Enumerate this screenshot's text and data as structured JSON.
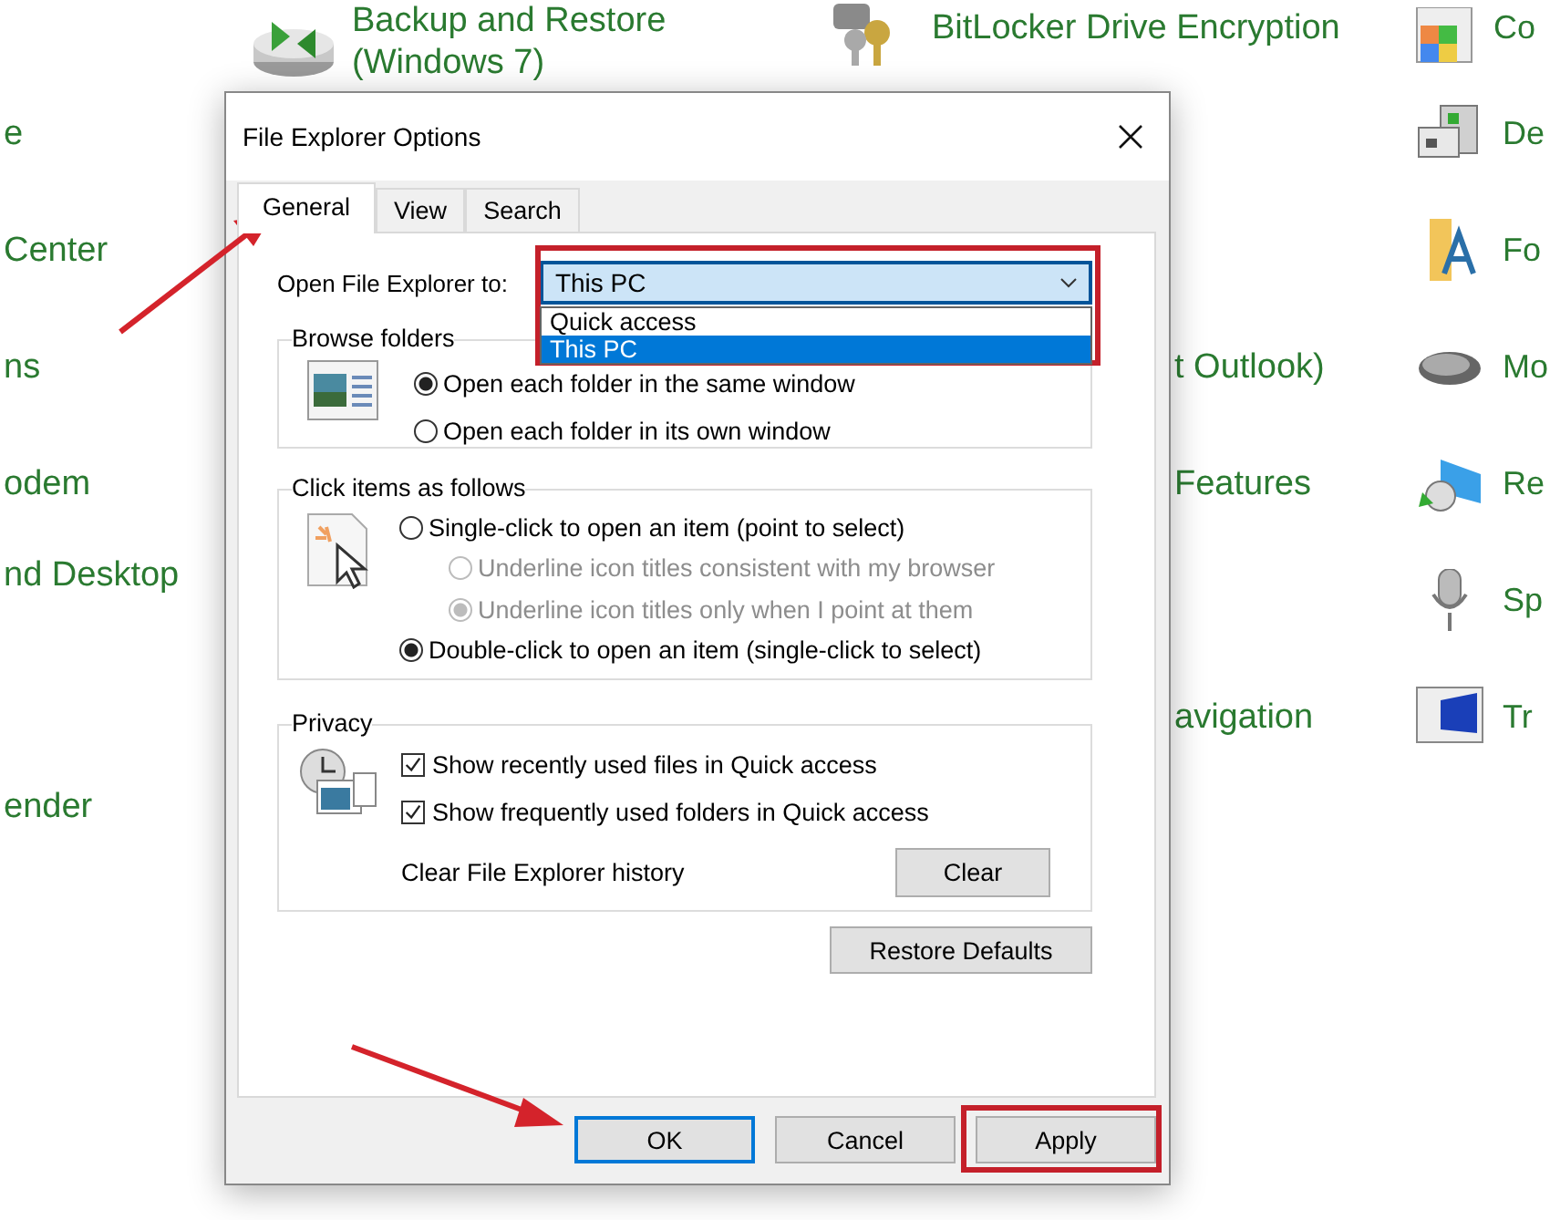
{
  "background": {
    "top": [
      {
        "lines": [
          "Backup and Restore",
          "(Windows 7)"
        ]
      },
      {
        "lines": [
          "BitLocker Drive Encryption"
        ]
      },
      {
        "lines": [
          "Co"
        ]
      }
    ],
    "rows": [
      {
        "left": "e",
        "right": "De"
      },
      {
        "left": "Center",
        "right": "Fo"
      },
      {
        "left": "ns",
        "middle": "t Outlook)",
        "right": "Mo"
      },
      {
        "left": "odem",
        "middle": "Features",
        "right": "Re"
      },
      {
        "left": "nd Desktop",
        "right": "Sp"
      },
      {
        "middle": "avigation",
        "right": "Tr"
      },
      {
        "left": "ender"
      }
    ]
  },
  "dialog": {
    "title": "File Explorer Options",
    "tabs": [
      {
        "label": "General",
        "selected": true
      },
      {
        "label": "View",
        "selected": false
      },
      {
        "label": "Search",
        "selected": false
      }
    ],
    "open_to": {
      "label": "Open File Explorer to:",
      "value": "This PC",
      "expanded": true,
      "options": [
        {
          "label": "Quick access",
          "selected": false
        },
        {
          "label": "This PC",
          "selected": true
        }
      ]
    },
    "groups": [
      {
        "kind": "radios",
        "legend": "Browse folders",
        "options": [
          {
            "label": "Open each folder in the same window",
            "selected": true,
            "disabled": false
          },
          {
            "label": "Open each folder in its own window",
            "selected": false,
            "disabled": false
          }
        ]
      },
      {
        "kind": "radios",
        "legend": "Click items as follows",
        "options": [
          {
            "label": "Single-click to open an item (point to select)",
            "selected": false,
            "disabled": false,
            "children": [
              {
                "label": "Underline icon titles consistent with my browser",
                "selected": false,
                "disabled": true
              },
              {
                "label": "Underline icon titles only when I point at them",
                "selected": true,
                "disabled": true
              }
            ]
          },
          {
            "label": "Double-click to open an item (single-click to select)",
            "selected": true,
            "disabled": false
          }
        ]
      },
      {
        "kind": "privacy",
        "legend": "Privacy",
        "checks": [
          {
            "label": "Show recently used files in Quick access",
            "checked": true
          },
          {
            "label": "Show frequently used folders in Quick access",
            "checked": true
          }
        ],
        "history_label": "Clear File Explorer history",
        "clear_button": "Clear"
      }
    ],
    "restore_button": "Restore Defaults",
    "buttons": [
      {
        "label": "OK",
        "default": true
      },
      {
        "label": "Cancel",
        "default": false
      },
      {
        "label": "Apply",
        "default": false
      }
    ]
  }
}
